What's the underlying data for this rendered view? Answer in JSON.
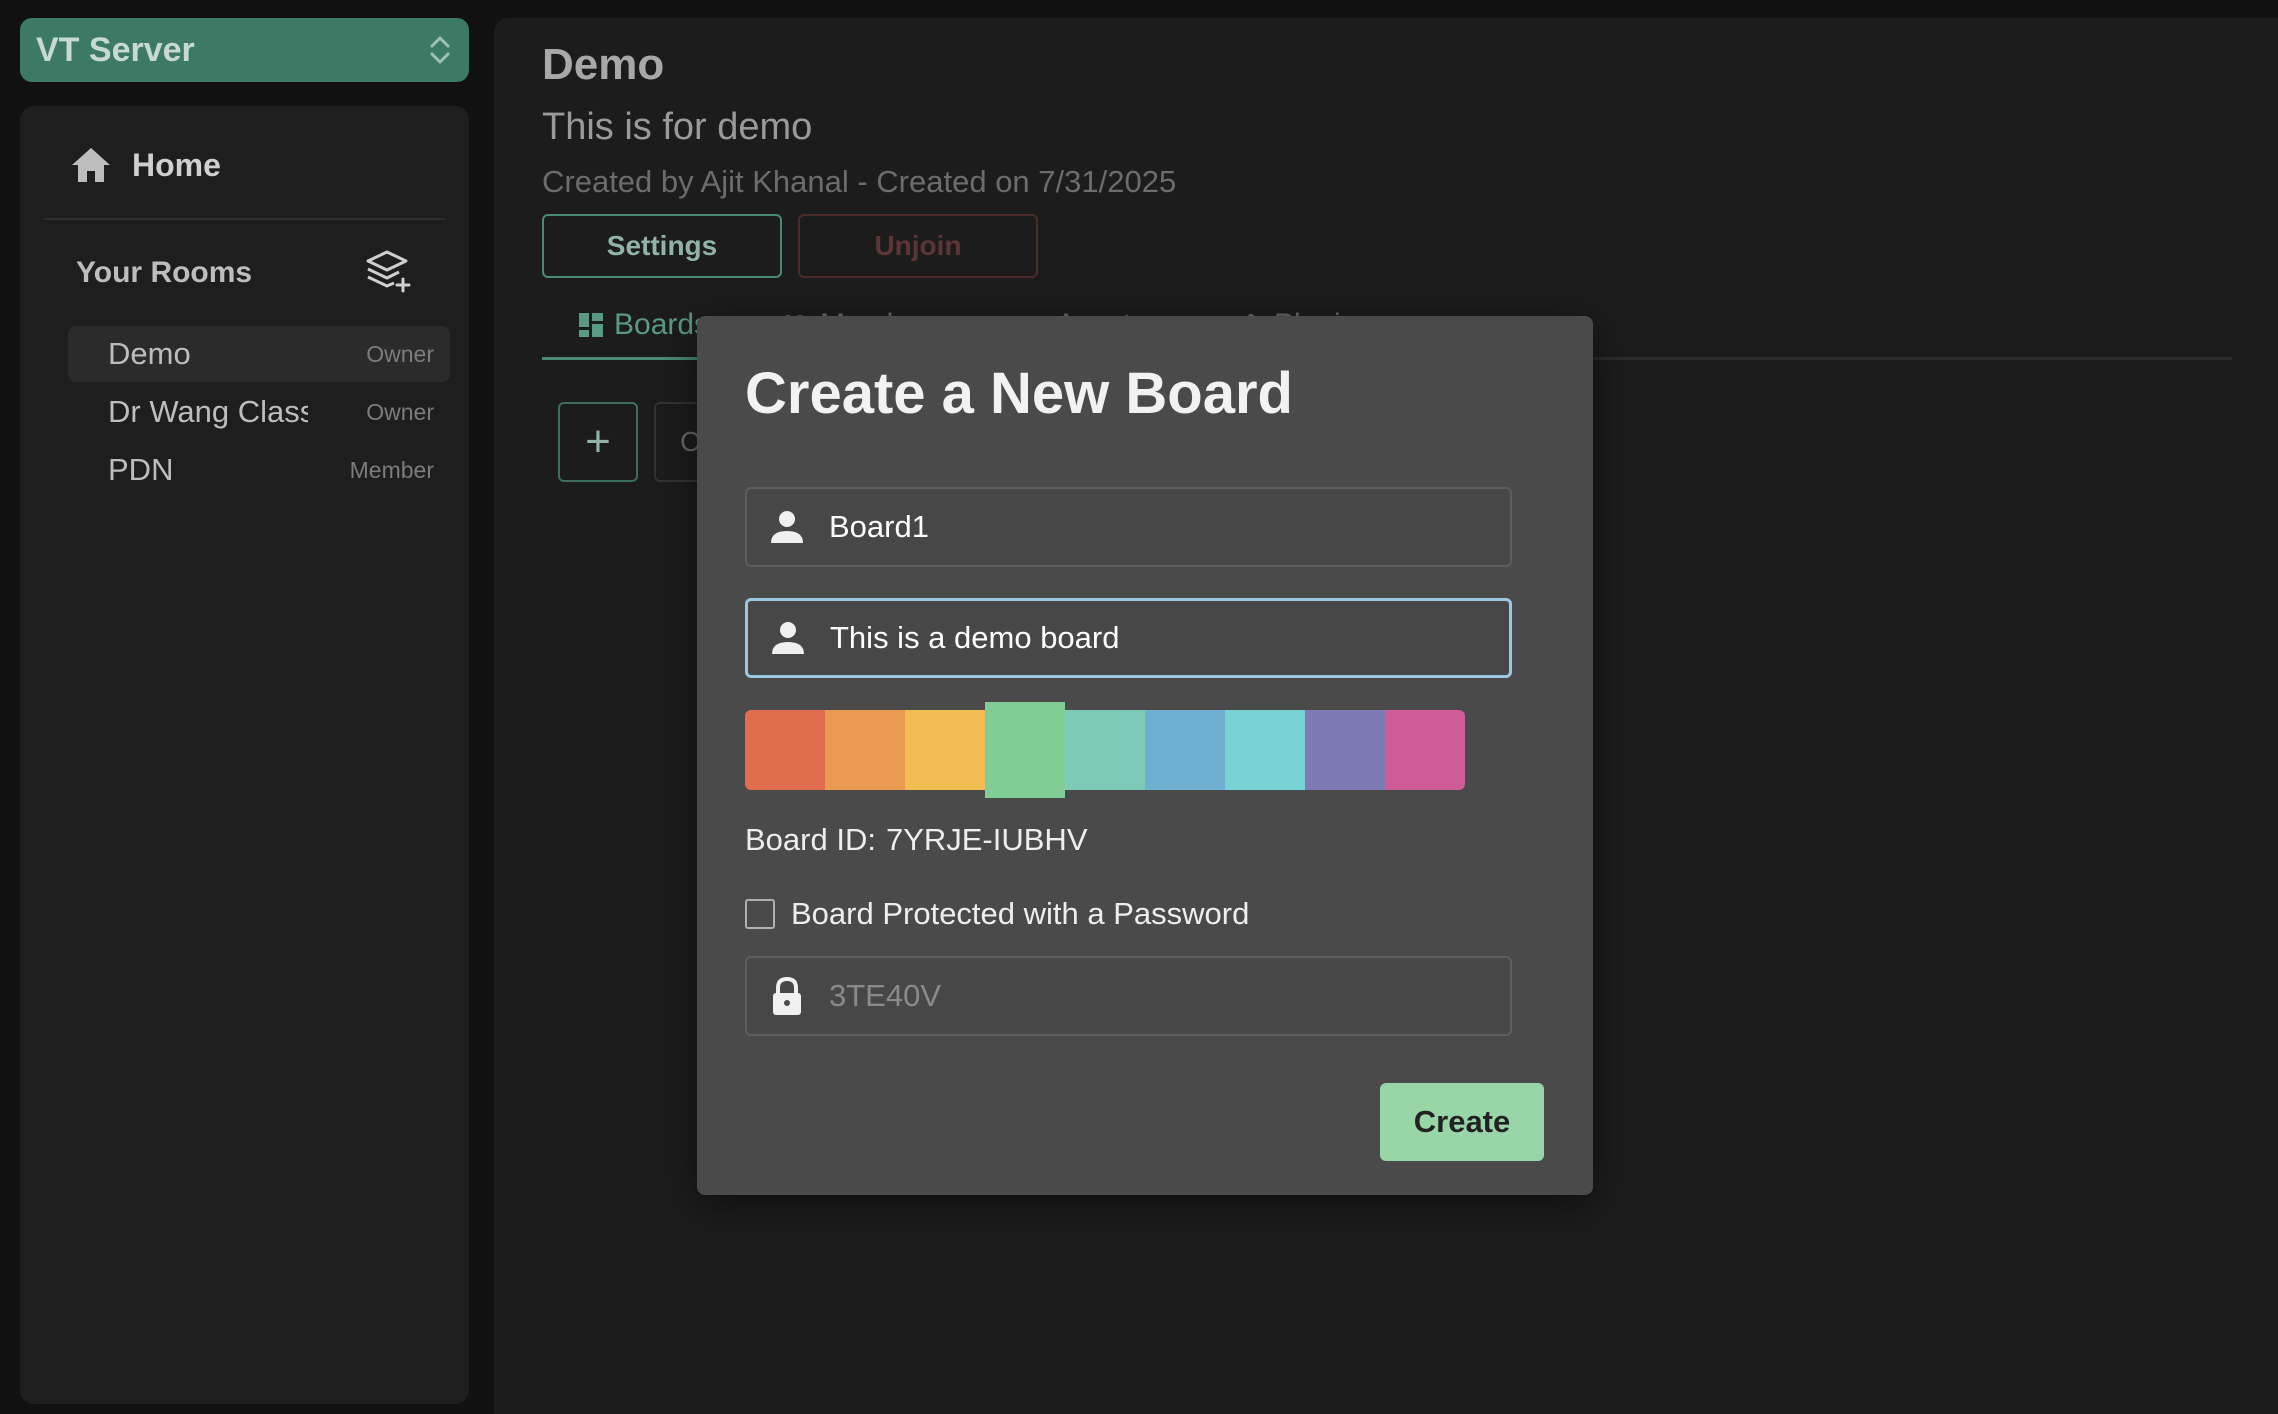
{
  "server": {
    "name": "VT Server"
  },
  "sidebar": {
    "home_label": "Home",
    "rooms_title": "Your Rooms",
    "rooms": [
      {
        "name": "Demo",
        "role": "Owner",
        "active": true
      },
      {
        "name": "Dr Wang Class",
        "role": "Owner",
        "active": false
      },
      {
        "name": "PDN",
        "role": "Member",
        "active": false
      }
    ]
  },
  "room": {
    "title": "Demo",
    "description": "This is for demo",
    "meta": "Created by Ajit Khanal  - Created on 7/31/2025",
    "settings_label": "Settings",
    "unjoin_label": "Unjoin",
    "tabs": [
      {
        "label": "Boards",
        "icon": "grid-icon",
        "active": true
      },
      {
        "label": "Members",
        "icon": "users-icon",
        "active": false
      },
      {
        "label": "Assets",
        "icon": "folder-icon",
        "active": false
      },
      {
        "label": "Plugins",
        "icon": "puzzle-icon",
        "active": false
      }
    ],
    "add_label": "+",
    "second_label": "C"
  },
  "modal": {
    "title": "Create a New Board",
    "name_value": "Board1",
    "description_value": "This is a demo board",
    "colors": [
      "#df6d4e",
      "#e99b52",
      "#f1bc52",
      "#81cd96",
      "#7ccab7",
      "#6eafd0",
      "#78d3d5",
      "#7e7ab5",
      "#cd5c97"
    ],
    "selected_color_index": 3,
    "board_id_label": "Board ID:",
    "board_id_value": "7YRJE-IUBHV",
    "password_checkbox_label": "Board Protected with a Password",
    "password_checked": false,
    "password_placeholder": "3TE40V",
    "create_label": "Create"
  },
  "colors": {
    "accent": "#3d7a66",
    "create_button": "#98d6a8",
    "focus_border": "#9cc7e3"
  }
}
